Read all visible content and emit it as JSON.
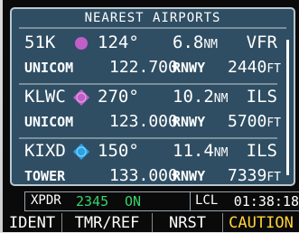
{
  "panel": {
    "title": "NEAREST AIRPORTS"
  },
  "airports": [
    {
      "ident": "51K",
      "symbol_icon": "airport-circle-icon",
      "symbol_color": "#c05fc8",
      "bearing": "124°",
      "distance_value": "6.8",
      "distance_unit": "NM",
      "approach": "VFR",
      "freq_name": "UNICOM",
      "frequency": "122.700",
      "runway_label": "RNWY",
      "runway_length": "2440",
      "runway_unit": "FT"
    },
    {
      "ident": "KLWC",
      "symbol_icon": "airport-diamond-icon",
      "symbol_color": "#c05fc8",
      "bearing": "270°",
      "distance_value": "10.2",
      "distance_unit": "NM",
      "approach": "ILS",
      "freq_name": "UNICOM",
      "frequency": "123.000",
      "runway_label": "RNWY",
      "runway_length": "5700",
      "runway_unit": "FT"
    },
    {
      "ident": "KIXD",
      "symbol_icon": "airport-towered-icon",
      "symbol_color": "#2aa3e6",
      "bearing": "150°",
      "distance_value": "11.4",
      "distance_unit": "NM",
      "approach": "ILS",
      "freq_name": "TOWER",
      "frequency": "133.000",
      "runway_label": "RNWY",
      "runway_length": "7339",
      "runway_unit": "FT"
    }
  ],
  "status": {
    "xpdr_label": "XPDR",
    "squawk": "2345",
    "mode": "ON",
    "time_label": "LCL",
    "time": "01:38:18"
  },
  "softkeys": [
    {
      "label": "IDENT",
      "highlight": false
    },
    {
      "label": "TMR/REF",
      "highlight": false
    },
    {
      "label": "NRST",
      "highlight": false
    },
    {
      "label": "CAUTION",
      "highlight": true
    }
  ]
}
